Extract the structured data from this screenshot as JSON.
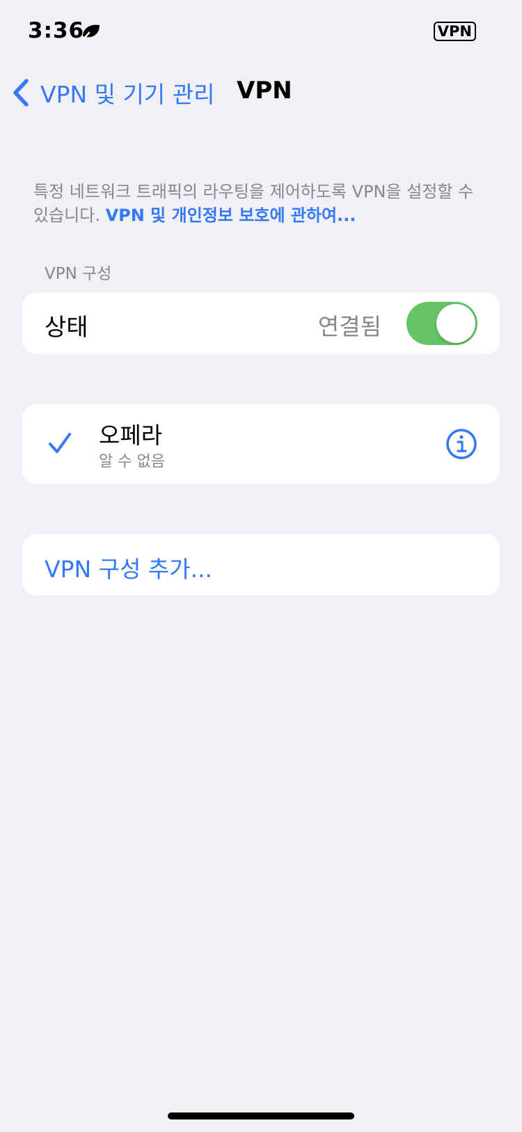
{
  "status_bar": {
    "time": "3:36",
    "vpn_badge": "VPN"
  },
  "nav": {
    "back_label": "VPN 및 기기 관리",
    "title": "VPN"
  },
  "intro": {
    "text": "특정 네트워크 트래픽의 라우팅을 제어하도록 VPN을 설정할 수 있습니다. ",
    "link": "VPN 및 개인정보 보호에 관하여..."
  },
  "section": {
    "header": "VPN 구성"
  },
  "status_row": {
    "label": "상태",
    "value": "연결됨",
    "toggle_on": true
  },
  "config": {
    "name": "오페라",
    "status": "알 수 없음",
    "selected": true
  },
  "add_config": {
    "label": "VPN 구성 추가..."
  },
  "colors": {
    "accent": "#3478f6",
    "toggle_on": "#65c466",
    "background": "#f0f0f5",
    "secondary_text": "#86868b"
  }
}
